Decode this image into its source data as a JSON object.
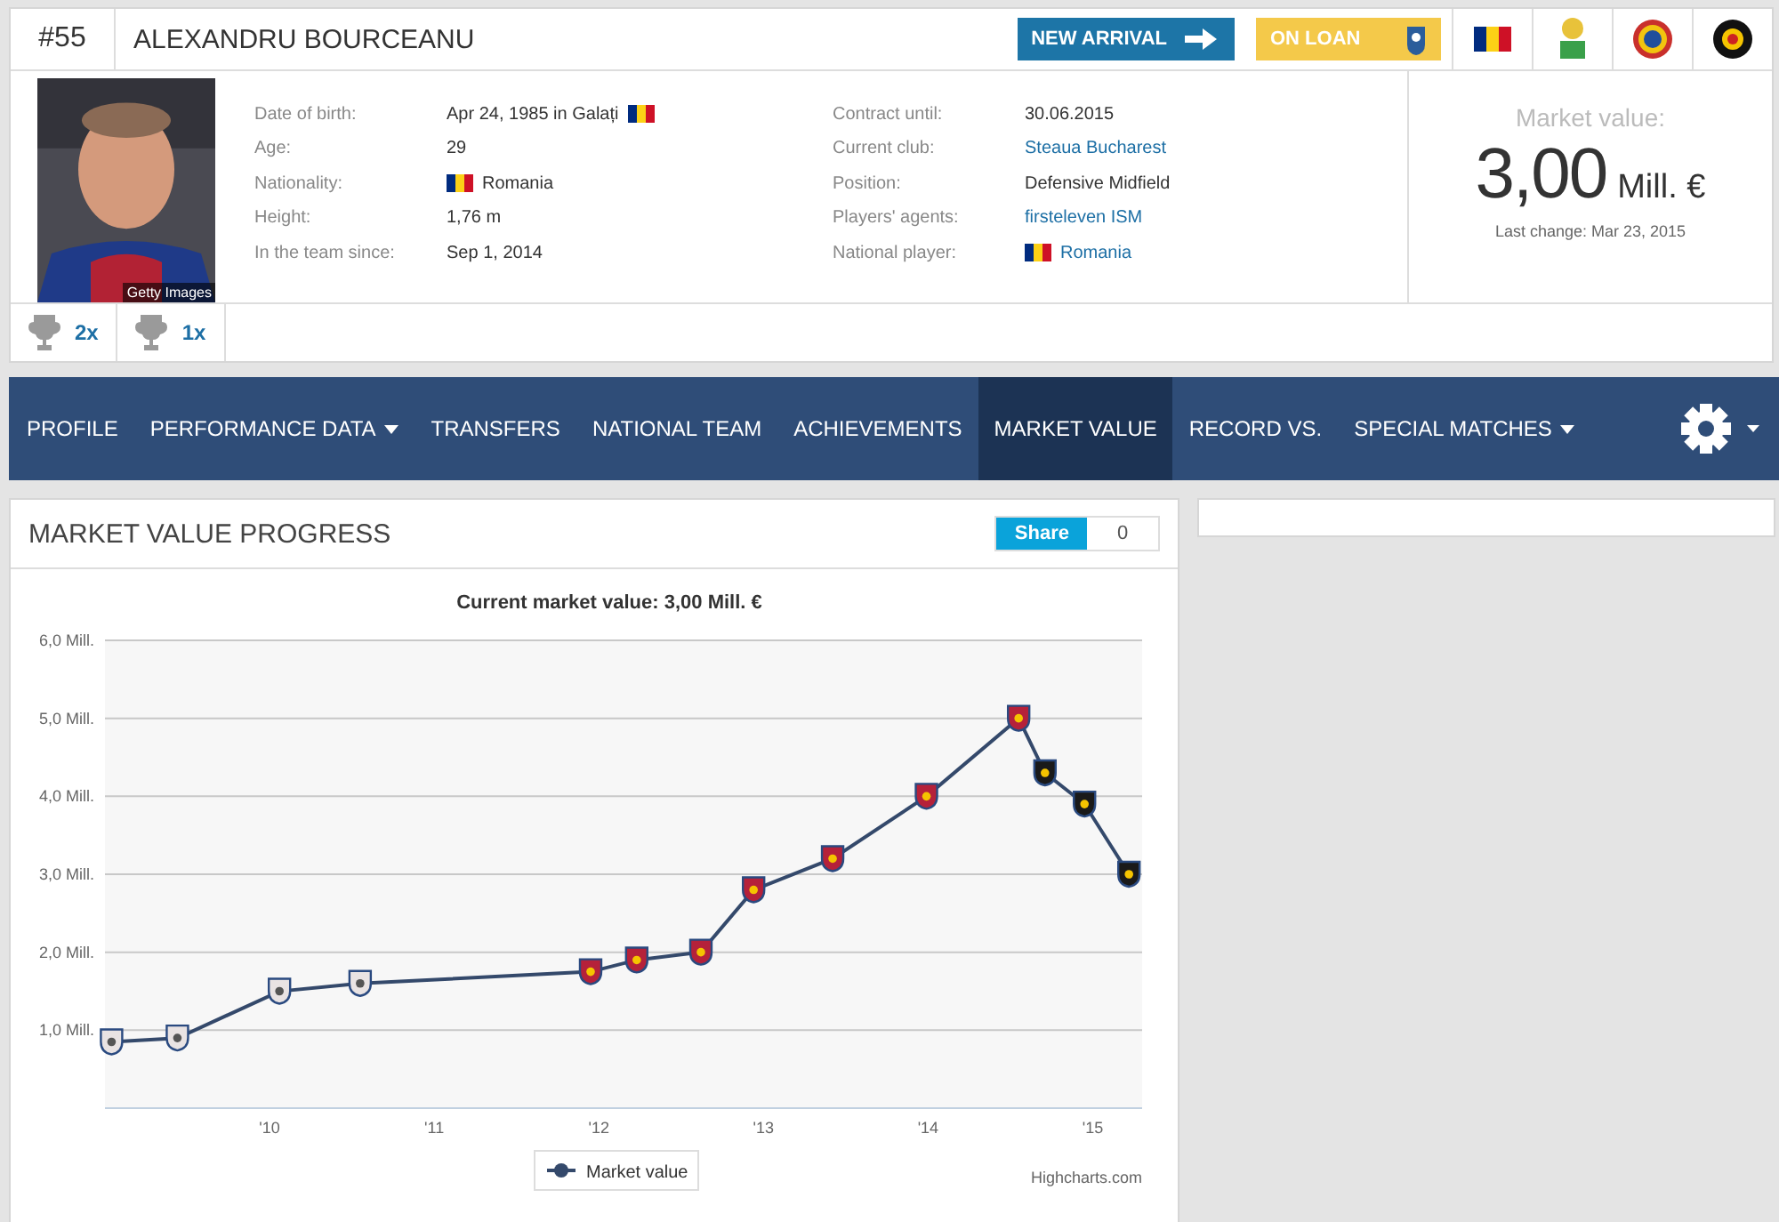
{
  "player": {
    "number": "#55",
    "name": "ALEXANDRU BOURCEANU",
    "badges": [
      {
        "label": "NEW ARRIVAL",
        "kind": "arrival"
      },
      {
        "label": "ON LOAN",
        "kind": "loan"
      }
    ],
    "photo_credit": "Getty Images"
  },
  "info_left": [
    {
      "label": "Date of birth:",
      "value": "Apr 24, 1985 in Galați",
      "flag": true,
      "link": false
    },
    {
      "label": "Age:",
      "value": "29",
      "flag": false,
      "link": false
    },
    {
      "label": "Nationality:",
      "value": "Romania",
      "flag": true,
      "link": false
    },
    {
      "label": "Height:",
      "value": "1,76 m",
      "flag": false,
      "link": false
    },
    {
      "label": "In the team since:",
      "value": "Sep 1, 2014",
      "flag": false,
      "link": false
    }
  ],
  "info_right": [
    {
      "label": "Contract until:",
      "value": "30.06.2015",
      "flag": false,
      "link": false
    },
    {
      "label": "Current club:",
      "value": "Steaua Bucharest",
      "flag": false,
      "link": true
    },
    {
      "label": "Position:",
      "value": "Defensive Midfield",
      "flag": false,
      "link": false
    },
    {
      "label": "Players' agents:",
      "value": "firsteleven ISM",
      "flag": false,
      "link": true
    },
    {
      "label": "National player:",
      "value": "Romania",
      "flag": true,
      "link": true
    }
  ],
  "market_value": {
    "label": "Market value:",
    "amount": "3,00",
    "unit": "Mill. €",
    "last_change": "Last change: Mar 23, 2015"
  },
  "trophies": [
    {
      "count": "2x"
    },
    {
      "count": "1x"
    }
  ],
  "nav": [
    {
      "label": "PROFILE",
      "selected": false,
      "dropdown": false
    },
    {
      "label": "PERFORMANCE DATA",
      "selected": false,
      "dropdown": true
    },
    {
      "label": "TRANSFERS",
      "selected": false,
      "dropdown": false
    },
    {
      "label": "NATIONAL TEAM",
      "selected": false,
      "dropdown": false
    },
    {
      "label": "ACHIEVEMENTS",
      "selected": false,
      "dropdown": false
    },
    {
      "label": "MARKET VALUE",
      "selected": true,
      "dropdown": false
    },
    {
      "label": "RECORD VS.",
      "selected": false,
      "dropdown": false
    },
    {
      "label": "SPECIAL MATCHES",
      "selected": false,
      "dropdown": true
    }
  ],
  "panel": {
    "title": "MARKET VALUE PROGRESS",
    "share": "Share",
    "share_count": "0",
    "chart_data": {
      "type": "line",
      "title": "Current market value: 3,00 Mill. €",
      "grid": true,
      "x": [
        2009.04,
        2009.44,
        2010.06,
        2010.55,
        2011.95,
        2012.23,
        2012.62,
        2012.94,
        2013.42,
        2013.99,
        2014.55,
        2014.71,
        2014.95,
        2015.22
      ],
      "series": [
        {
          "name": "Market value",
          "color": "#34496b",
          "marker": true,
          "values": [
            0.85,
            0.9,
            1.5,
            1.6,
            1.75,
            1.9,
            2.0,
            2.8,
            3.2,
            4.0,
            5.0,
            4.3,
            3.9,
            3.0
          ]
        }
      ],
      "xlim": [
        2009,
        2015.3
      ],
      "ylim": [
        0,
        6
      ],
      "xticks": [
        {
          "value": 2010,
          "label": "'10"
        },
        {
          "value": 2011,
          "label": "'11"
        },
        {
          "value": 2012,
          "label": "'12"
        },
        {
          "value": 2013,
          "label": "'13"
        },
        {
          "value": 2014,
          "label": "'14"
        },
        {
          "value": 2015,
          "label": "'15"
        }
      ],
      "yticks": [
        {
          "value": 1,
          "label": "1,0 Mill."
        },
        {
          "value": 2,
          "label": "2,0 Mill."
        },
        {
          "value": 3,
          "label": "3,0 Mill."
        },
        {
          "value": 4,
          "label": "4,0 Mill."
        },
        {
          "value": 5,
          "label": "5,0 Mill."
        },
        {
          "value": 6,
          "label": "6,0 Mill."
        }
      ]
    },
    "credit": "Highcharts.com"
  }
}
